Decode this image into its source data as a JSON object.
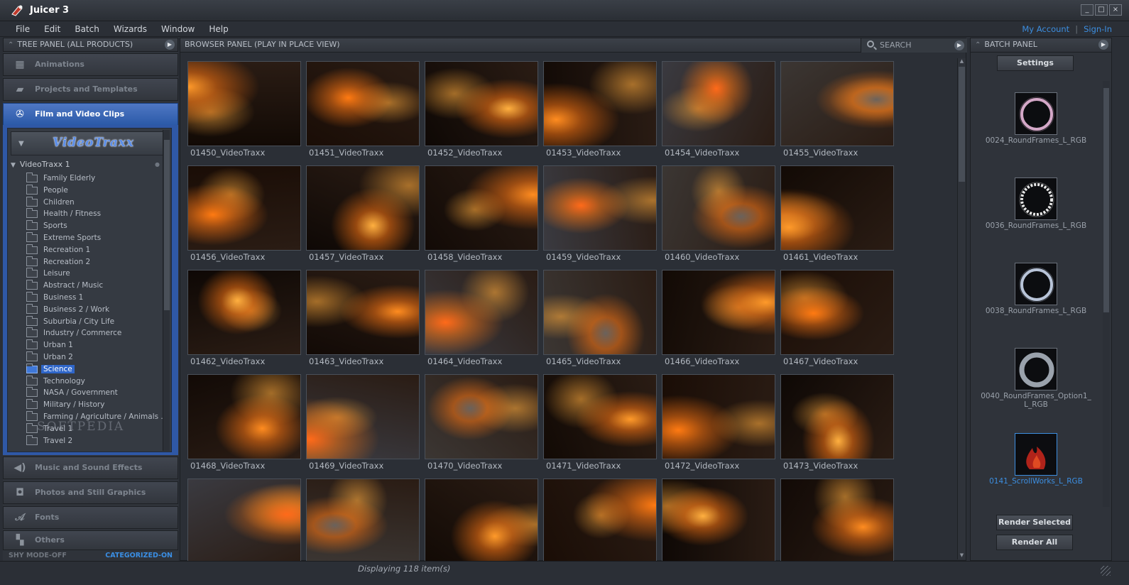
{
  "app": {
    "title": "Juicer 3"
  },
  "window_buttons": {
    "minimize": "_",
    "maximize": "□",
    "close": "×"
  },
  "menu": [
    "File",
    "Edit",
    "Batch",
    "Wizards",
    "Window",
    "Help"
  ],
  "account": {
    "my_account": "My Account",
    "separator": "|",
    "sign_in": "Sign-In"
  },
  "tree_panel": {
    "header": "TREE PANEL (ALL PRODUCTS)",
    "categories_top": [
      {
        "label": "Animations",
        "icon": "film-strip-icon"
      },
      {
        "label": "Projects and Templates",
        "icon": "folder-icon"
      },
      {
        "label": "Film and Video Clips",
        "icon": "film-reel-icon",
        "active": true
      }
    ],
    "product_logo": "VideoTraxx",
    "root": "VideoTraxx 1",
    "items": [
      "Family  Elderly",
      "People",
      "Children",
      "Health / Fitness",
      "Sports",
      "Extreme Sports",
      "Recreation 1",
      "Recreation 2",
      "Leisure",
      "Abstract / Music",
      "Business 1",
      "Business 2 / Work",
      "Suburbia / City Life",
      "Industry / Commerce",
      "Urban 1",
      "Urban 2",
      "Science",
      "Technology",
      "NASA / Government",
      "Military / History",
      "Farming / Agriculture / Animals ...",
      "Travel 1",
      "Travel 2"
    ],
    "selected_item": "Science",
    "categories_bottom": [
      {
        "label": "Music and Sound Effects",
        "icon": "speaker-icon"
      },
      {
        "label": "Photos and Still Graphics",
        "icon": "camera-icon"
      },
      {
        "label": "Fonts",
        "icon": "font-icon"
      },
      {
        "label": "Others",
        "icon": "others-icon"
      }
    ],
    "footer": {
      "shy_mode": "SHY MODE-OFF",
      "categorized": "CATEGORIZED-ON"
    },
    "watermark": "SOFTPEDIA"
  },
  "browser_panel": {
    "header": "BROWSER PANEL (PLAY IN PLACE VIEW)",
    "search_label": "SEARCH",
    "thumbnails": [
      "01450_VideoTraxx",
      "01451_VideoTraxx",
      "01452_VideoTraxx",
      "01453_VideoTraxx",
      "01454_VideoTraxx",
      "01455_VideoTraxx",
      "01456_VideoTraxx",
      "01457_VideoTraxx",
      "01458_VideoTraxx",
      "01459_VideoTraxx",
      "01460_VideoTraxx",
      "01461_VideoTraxx",
      "01462_VideoTraxx",
      "01463_VideoTraxx",
      "01464_VideoTraxx",
      "01465_VideoTraxx",
      "01466_VideoTraxx",
      "01467_VideoTraxx",
      "01468_VideoTraxx",
      "01469_VideoTraxx",
      "01470_VideoTraxx",
      "01471_VideoTraxx",
      "01472_VideoTraxx",
      "01473_VideoTraxx",
      "",
      "",
      "",
      "",
      "",
      ""
    ]
  },
  "batch_panel": {
    "header": "BATCH PANEL",
    "settings": "Settings",
    "items": [
      {
        "label": "0024_RoundFrames_L_RGB",
        "selected": false
      },
      {
        "label": "0036_RoundFrames_L_RGB",
        "selected": false
      },
      {
        "label": "0038_RoundFrames_L_RGB",
        "selected": false
      },
      {
        "label": "0040_RoundFrames_Option1_L_RGB",
        "selected": false
      },
      {
        "label": "0141_ScrollWorks_L_RGB",
        "selected": true
      }
    ],
    "render_selected": "Render Selected",
    "render_all": "Render All"
  },
  "status": {
    "message": "Displaying 118 item(s)"
  },
  "colors": {
    "accent_blue": "#2f66c9",
    "link_blue": "#3c8ee0",
    "background": "#2b2f36"
  }
}
